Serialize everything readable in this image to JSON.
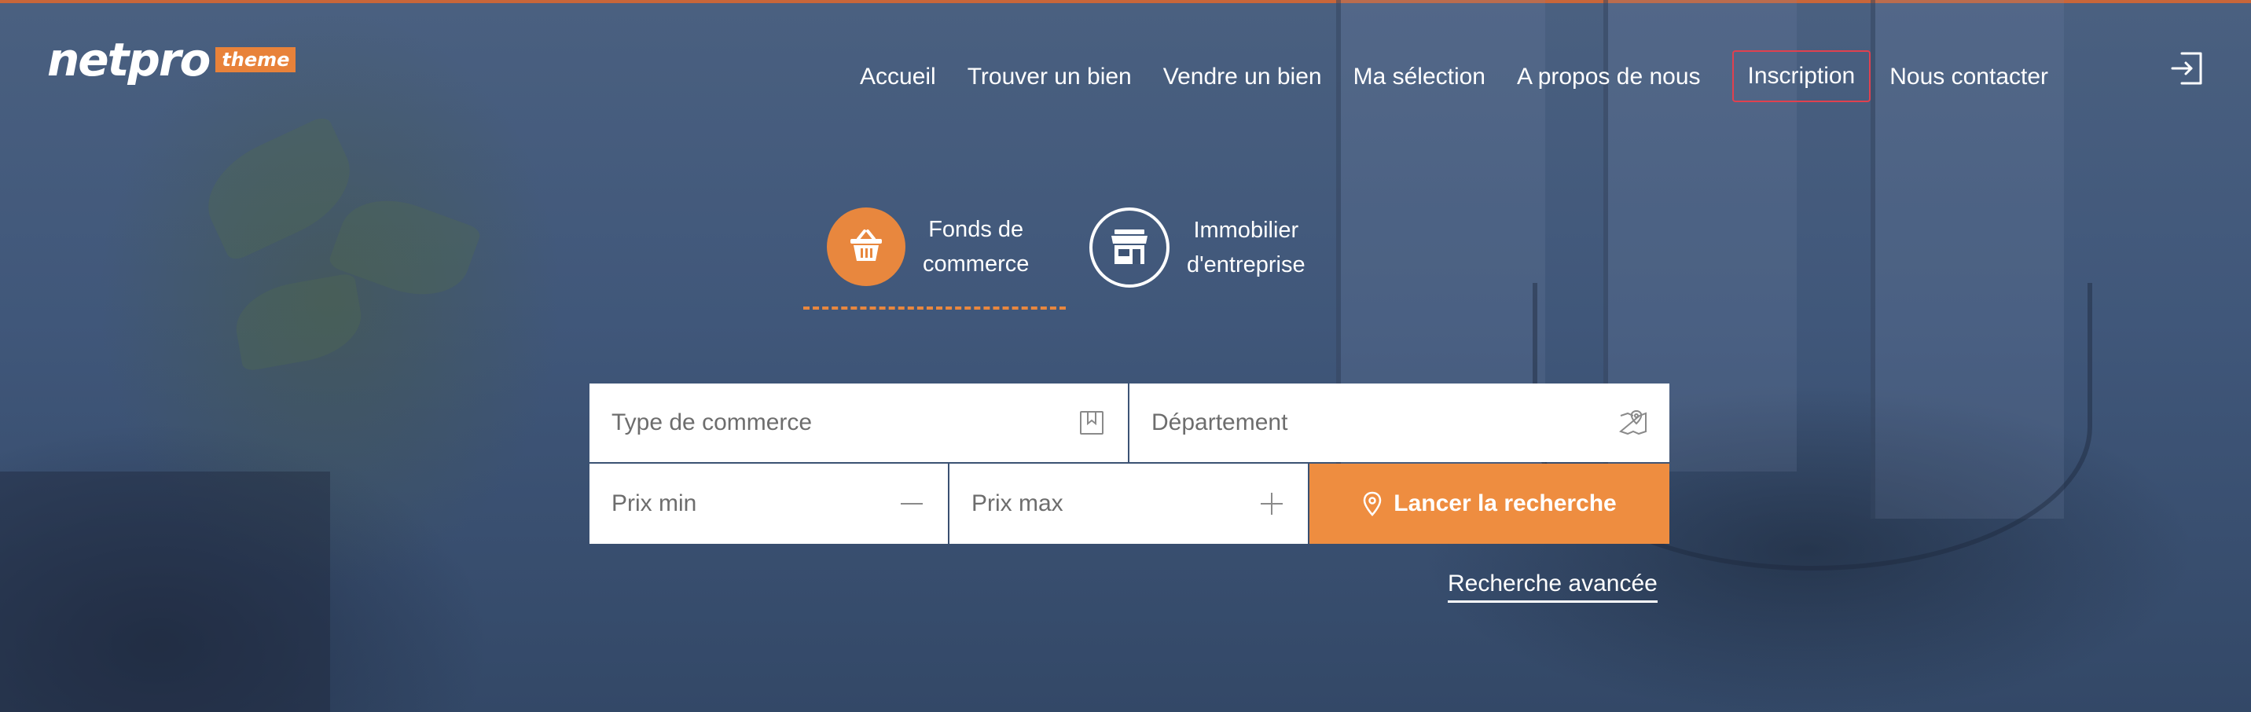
{
  "brand": {
    "name": "netpro",
    "tag": "theme",
    "accent": "#e8823a"
  },
  "nav": {
    "items": [
      {
        "label": "Accueil"
      },
      {
        "label": "Trouver un bien"
      },
      {
        "label": "Vendre un bien"
      },
      {
        "label": "Ma sélection"
      },
      {
        "label": "A propos de nous"
      },
      {
        "label": "Inscription"
      },
      {
        "label": "Nous contacter"
      }
    ],
    "login_icon": "sign-in-icon"
  },
  "categories": [
    {
      "label_line1": "Fonds de",
      "label_line2": "commerce",
      "icon": "basket-icon",
      "active": true
    },
    {
      "label_line1": "Immobilier",
      "label_line2": "d'entreprise",
      "icon": "storefront-icon",
      "active": false
    }
  ],
  "search": {
    "type_placeholder": "Type de commerce",
    "department_placeholder": "Département",
    "price_min_placeholder": "Prix min",
    "price_max_placeholder": "Prix max",
    "submit_label": "Lancer la recherche",
    "button_color": "#ee8d40"
  },
  "advanced_search_label": "Recherche avancée",
  "colors": {
    "accent": "#e8873e",
    "inscription_border": "#e0414f"
  }
}
